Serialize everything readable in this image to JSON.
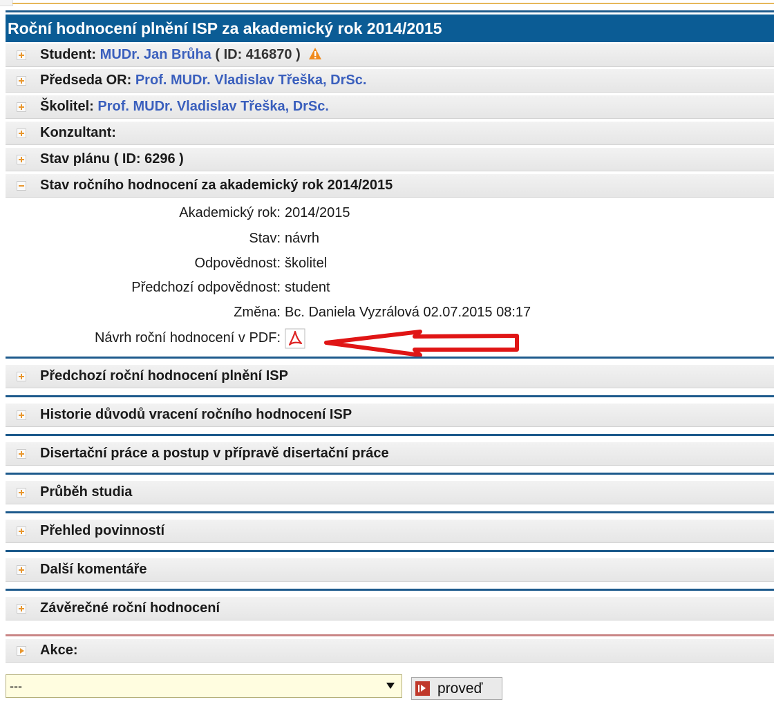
{
  "title": "Roční hodnocení plnění ISP za akademický rok 2014/2015",
  "student": {
    "label": "Student:",
    "name": "MUDr. Jan Brůha",
    "id_text": "( ID: 416870 )"
  },
  "predseda": {
    "label": "Předseda OR:",
    "name": "Prof. MUDr. Vladislav Třeška, DrSc."
  },
  "skolitel": {
    "label": "Školitel:",
    "name": "Prof. MUDr. Vladislav Třeška, DrSc."
  },
  "konzultant": {
    "label": "Konzultant:"
  },
  "stav_planu": {
    "label": "Stav plánu ( ID: 6296 )"
  },
  "stav_hodnoceni": {
    "label": "Stav ročního hodnocení za akademický rok 2014/2015",
    "fields": [
      {
        "label": "Akademický rok:",
        "value": "2014/2015"
      },
      {
        "label": "Stav:",
        "value": "návrh"
      },
      {
        "label": "Odpovědnost:",
        "value": "školitel"
      },
      {
        "label": "Předchozí odpovědnost:",
        "value": "student"
      },
      {
        "label": "Změna:",
        "value": "Bc. Daniela Vyzrálová 02.07.2015 08:17"
      },
      {
        "label": "Návrh roční hodnocení v PDF:",
        "value": ""
      }
    ]
  },
  "sections": [
    "Předchozí roční hodnocení plnění ISP",
    "Historie důvodů vracení ročního hodnocení ISP",
    "Disertační práce a postup v přípravě disertační práce",
    "Průběh studia",
    "Přehled povinností",
    "Další komentáře",
    "Závěrečné roční hodnocení"
  ],
  "akce": {
    "label": "Akce:",
    "select_value": "---",
    "button_label": "proveď"
  },
  "colors": {
    "header_blue": "#0b5c95",
    "link_blue": "#3a5fbd",
    "accent_orange": "#e9972f",
    "arrow_red": "#e01515"
  }
}
